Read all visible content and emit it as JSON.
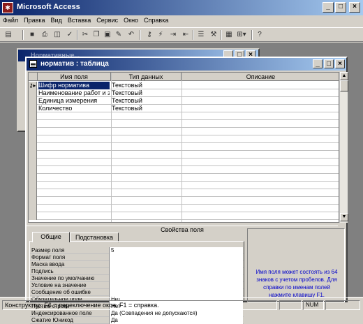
{
  "app": {
    "title": "Microsoft Access",
    "icon": "access-key-icon"
  },
  "menu": [
    "Файл",
    "Правка",
    "Вид",
    "Вставка",
    "Сервис",
    "Окно",
    "Справка"
  ],
  "toolbar": {
    "icons": [
      "view-icon",
      "save-icon",
      "print-icon",
      "preview-icon",
      "spelling-icon",
      "cut-icon",
      "copy-icon",
      "paste-icon",
      "format-painter-icon",
      "undo-icon",
      "primary-key-icon",
      "indexes-icon",
      "insert-rows-icon",
      "delete-rows-icon",
      "properties-icon",
      "build-icon",
      "database-window-icon",
      "new-object-icon",
      "help-icon"
    ]
  },
  "db_window": {
    "title": "Нормативные..."
  },
  "table_window": {
    "title": "норматив : таблица",
    "columns": [
      "Имя поля",
      "Тип данных",
      "Описание"
    ],
    "rows": [
      {
        "name": "Шифр норматива",
        "type": "Текстовый",
        "desc": ""
      },
      {
        "name": "Наименование работ и затр",
        "type": "Текстовый",
        "desc": ""
      },
      {
        "name": "Единица измерения",
        "type": "Текстовый",
        "desc": ""
      },
      {
        "name": "Количество",
        "type": "Текстовый",
        "desc": ""
      }
    ],
    "props_header": "Свойства поля",
    "tabs": [
      "Общие",
      "Подстановка"
    ],
    "properties": [
      {
        "name": "Размер поля",
        "value": "5"
      },
      {
        "name": "Формат поля",
        "value": ""
      },
      {
        "name": "Маска ввода",
        "value": ""
      },
      {
        "name": "Подпись",
        "value": ""
      },
      {
        "name": "Значение по умолчанию",
        "value": ""
      },
      {
        "name": "Условие на значение",
        "value": ""
      },
      {
        "name": "Сообщение об ошибке",
        "value": ""
      },
      {
        "name": "Обязательное поле",
        "value": "Нет"
      },
      {
        "name": "Пустые строки",
        "value": "Нет"
      },
      {
        "name": "Индексированное поле",
        "value": "Да (Совпадения не допускаются)"
      },
      {
        "name": "Сжатие Юникод",
        "value": "Да"
      }
    ],
    "help": "Имя поля может состоять из 64 знаков с учетом пробелов. Для справки по именам полей нажмите клавишу F1."
  },
  "status": {
    "text": "Конструктор. F6 = переключение окон. F1 = справка.",
    "num": "NUM"
  },
  "colors": {
    "title_bar": "#0a246a",
    "help_text": "#0000cc"
  }
}
